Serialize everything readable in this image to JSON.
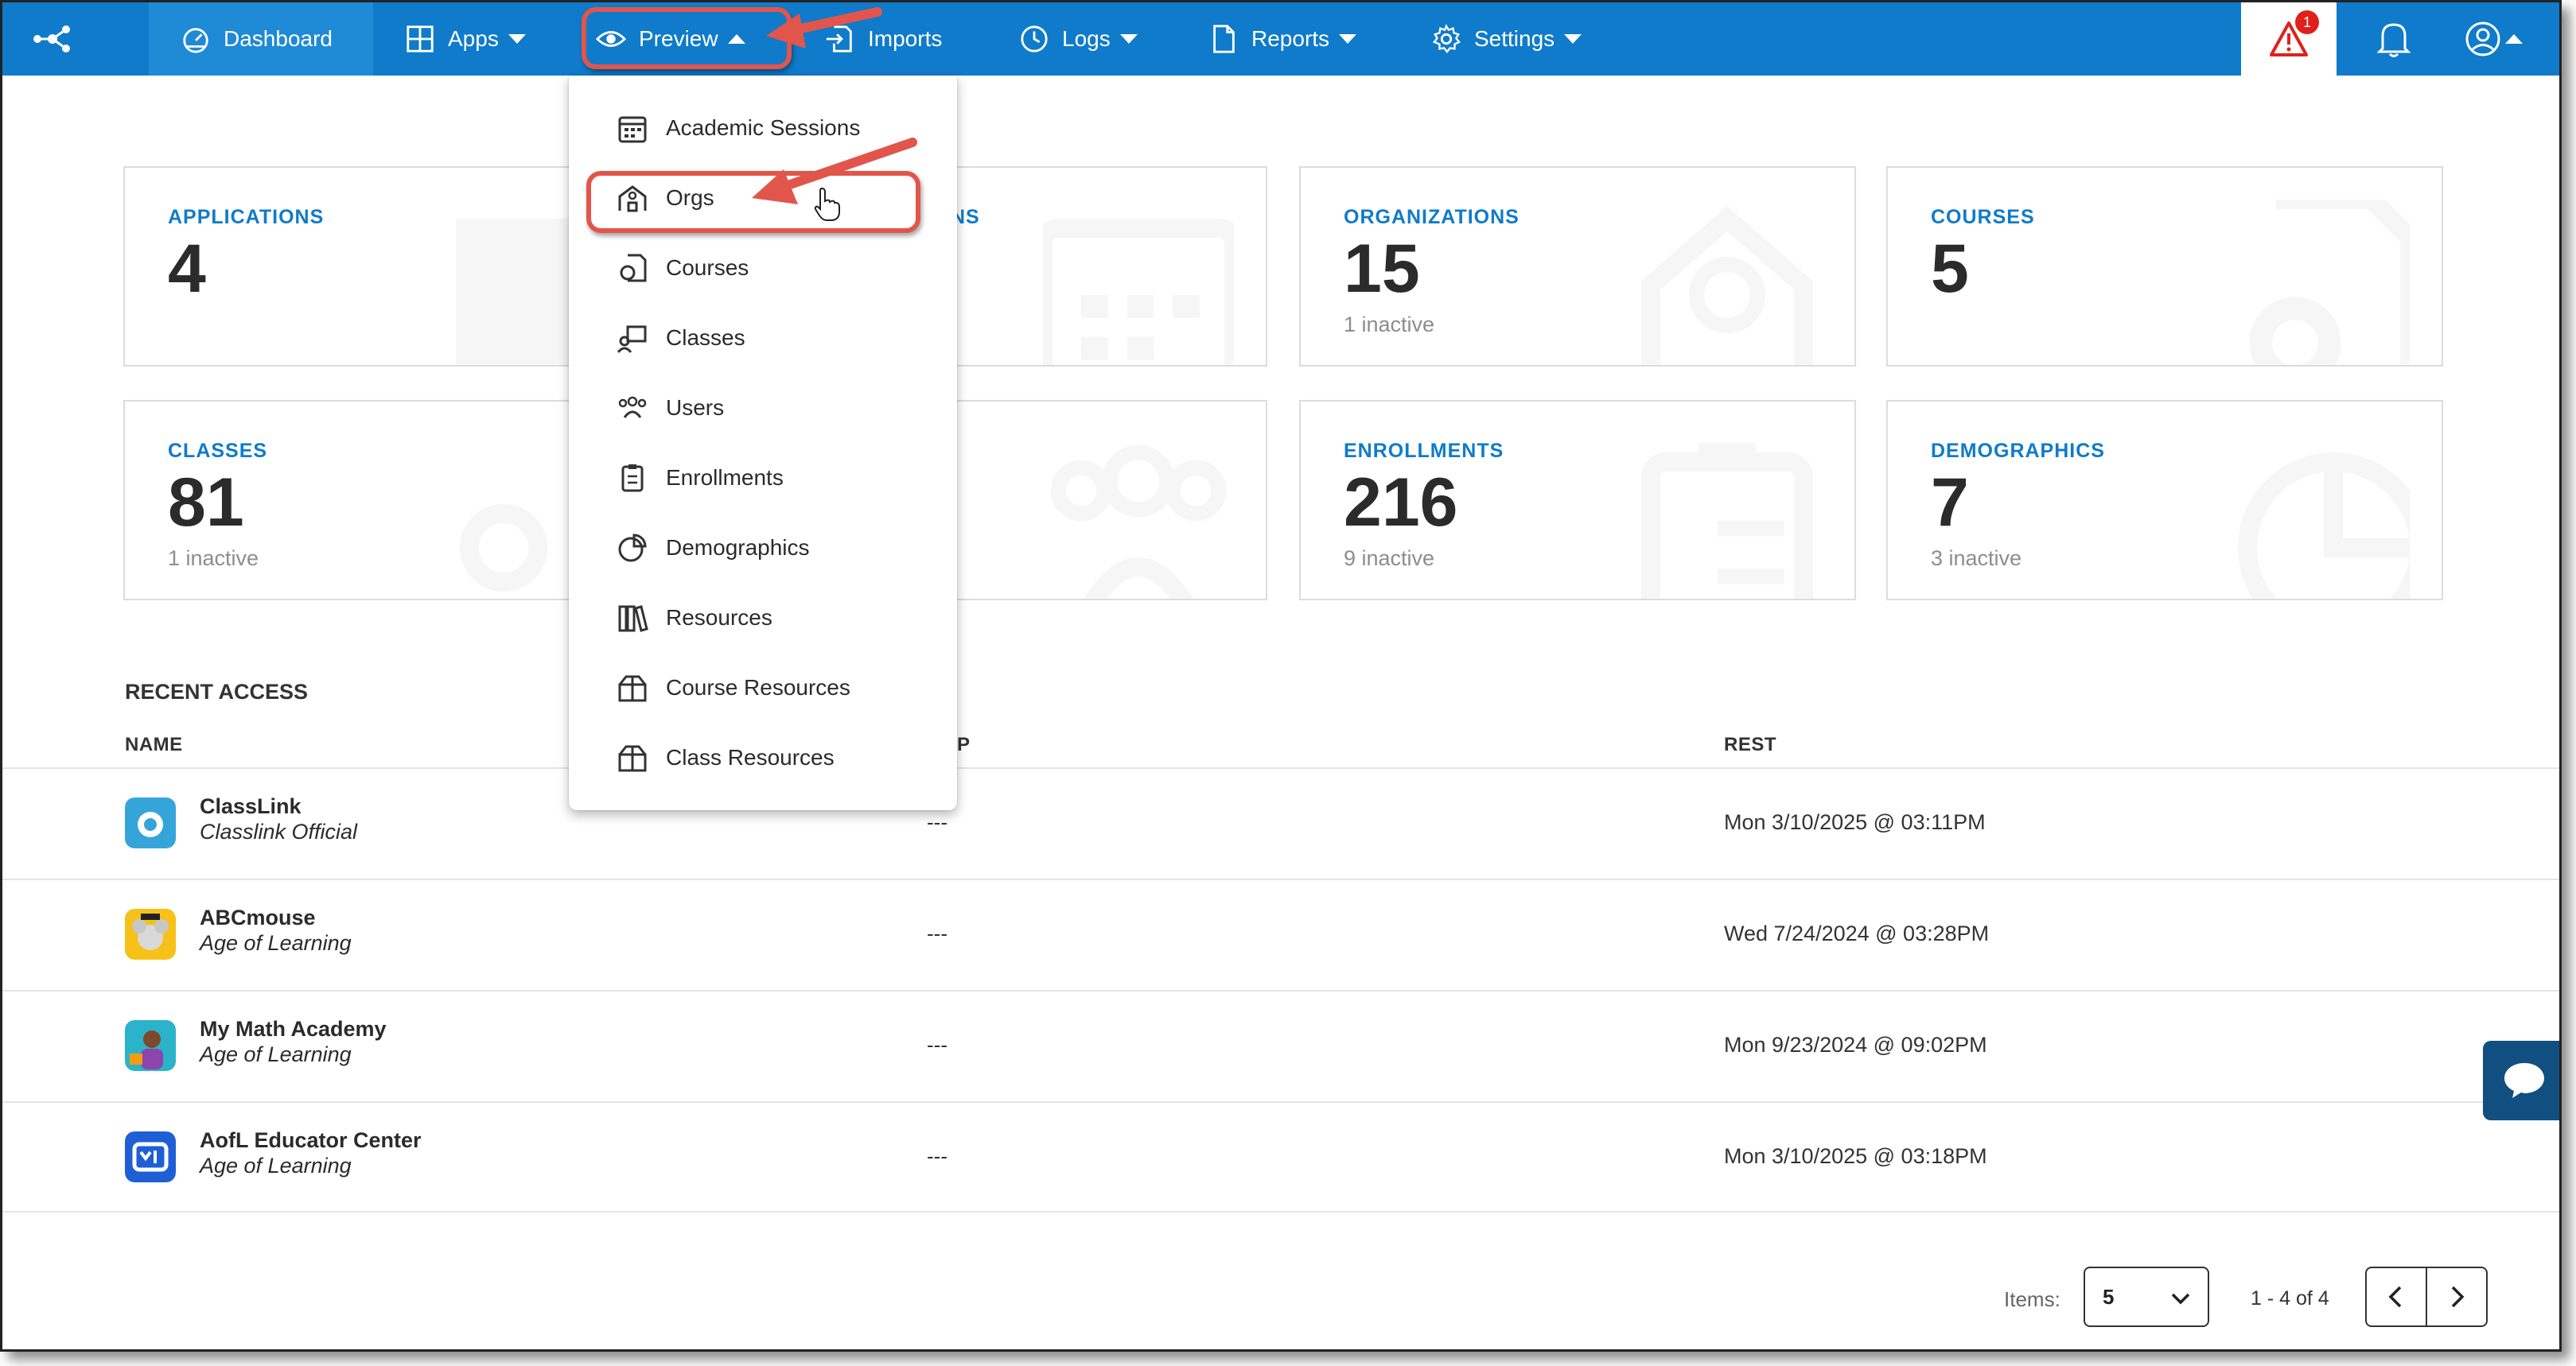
{
  "nav": {
    "items": [
      {
        "label": "Dashboard",
        "icon": "dashboard-gauge-icon"
      },
      {
        "label": "Apps",
        "icon": "grid-icon"
      },
      {
        "label": "Preview",
        "icon": "eye-icon"
      },
      {
        "label": "Imports",
        "icon": "import-icon"
      },
      {
        "label": "Logs",
        "icon": "clock-icon"
      },
      {
        "label": "Reports",
        "icon": "document-icon"
      },
      {
        "label": "Settings",
        "icon": "gear-icon"
      }
    ],
    "alert_count": "1"
  },
  "cards": [
    {
      "title": "APPLICATIONS",
      "value": "4",
      "sub": ""
    },
    {
      "title": "ORGANIZATIONS",
      "value": "15",
      "sub": "1 inactive"
    },
    {
      "title": "COURSES",
      "value": "5",
      "sub": ""
    },
    {
      "title": "CLASSES",
      "value": "81",
      "sub": "1 inactive"
    },
    {
      "title": "ENROLLMENTS",
      "value": "216",
      "sub": "9 inactive"
    },
    {
      "title": "DEMOGRAPHICS",
      "value": "7",
      "sub": "3 inactive"
    },
    {
      "title_fragment": "NS"
    }
  ],
  "recent": {
    "title": "RECENT ACCESS",
    "columns": {
      "name": "NAME",
      "mid_fragment": "P",
      "rest": "REST"
    },
    "rows": [
      {
        "name": "ClassLink",
        "publisher": "Classlink Official",
        "dash": "---",
        "rest": "Mon 3/10/2025 @ 03:11PM"
      },
      {
        "name": "ABCmouse",
        "publisher": "Age of Learning",
        "dash": "---",
        "rest": "Wed 7/24/2024 @ 03:28PM"
      },
      {
        "name": "My Math Academy",
        "publisher": "Age of Learning",
        "dash": "---",
        "rest": "Mon 9/23/2024 @ 09:02PM"
      },
      {
        "name": "AofL Educator Center",
        "publisher": "Age of Learning",
        "dash": "---",
        "rest": "Mon 3/10/2025 @ 03:18PM"
      }
    ]
  },
  "pager": {
    "items_label": "Items:",
    "items_value": "5",
    "range": "1 - 4 of 4"
  },
  "dropdown": {
    "items": [
      {
        "label": "Academic Sessions",
        "icon": "calendar-icon"
      },
      {
        "label": "Orgs",
        "icon": "school-building-icon"
      },
      {
        "label": "Courses",
        "icon": "course-badge-icon"
      },
      {
        "label": "Classes",
        "icon": "classroom-icon"
      },
      {
        "label": "Users",
        "icon": "users-icon"
      },
      {
        "label": "Enrollments",
        "icon": "clipboard-icon"
      },
      {
        "label": "Demographics",
        "icon": "pie-chart-icon"
      },
      {
        "label": "Resources",
        "icon": "books-icon"
      },
      {
        "label": "Course Resources",
        "icon": "resource-box-icon"
      },
      {
        "label": "Class Resources",
        "icon": "resource-box-icon"
      }
    ]
  },
  "colors": {
    "brand_blue": "#0f7bca",
    "highlight_red": "#e2554b",
    "alert_red": "#e0201b",
    "chat_navy": "#104f80"
  }
}
